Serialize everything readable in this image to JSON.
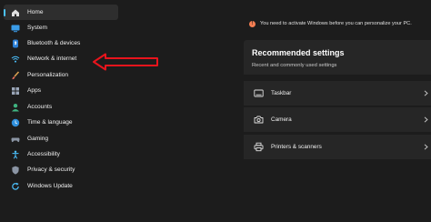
{
  "sidebar": {
    "items": [
      {
        "label": "Home",
        "icon": "home-icon",
        "active": true
      },
      {
        "label": "System",
        "icon": "system-icon"
      },
      {
        "label": "Bluetooth & devices",
        "icon": "bluetooth-icon"
      },
      {
        "label": "Network & internet",
        "icon": "wifi-icon"
      },
      {
        "label": "Personalization",
        "icon": "brush-icon"
      },
      {
        "label": "Apps",
        "icon": "apps-icon"
      },
      {
        "label": "Accounts",
        "icon": "person-icon"
      },
      {
        "label": "Time & language",
        "icon": "globe-clock-icon"
      },
      {
        "label": "Gaming",
        "icon": "gamepad-icon"
      },
      {
        "label": "Accessibility",
        "icon": "accessibility-icon"
      },
      {
        "label": "Privacy & security",
        "icon": "shield-icon"
      },
      {
        "label": "Windows Update",
        "icon": "update-icon"
      }
    ]
  },
  "banner": {
    "text": "You need to activate Windows before you can personalize your PC.",
    "icon": "warning-icon"
  },
  "recommended": {
    "title": "Recommended settings",
    "subtitle": "Recent and commonly used settings",
    "items": [
      {
        "label": "Taskbar",
        "icon": "taskbar-icon"
      },
      {
        "label": "Camera",
        "icon": "camera-icon"
      },
      {
        "label": "Printers & scanners",
        "icon": "printer-icon"
      }
    ]
  },
  "colors": {
    "background": "#1c1c1c",
    "card": "#262626",
    "accent": "#4cc2ff",
    "annotation_arrow": "#e8141c",
    "warning": "#f57e52"
  }
}
